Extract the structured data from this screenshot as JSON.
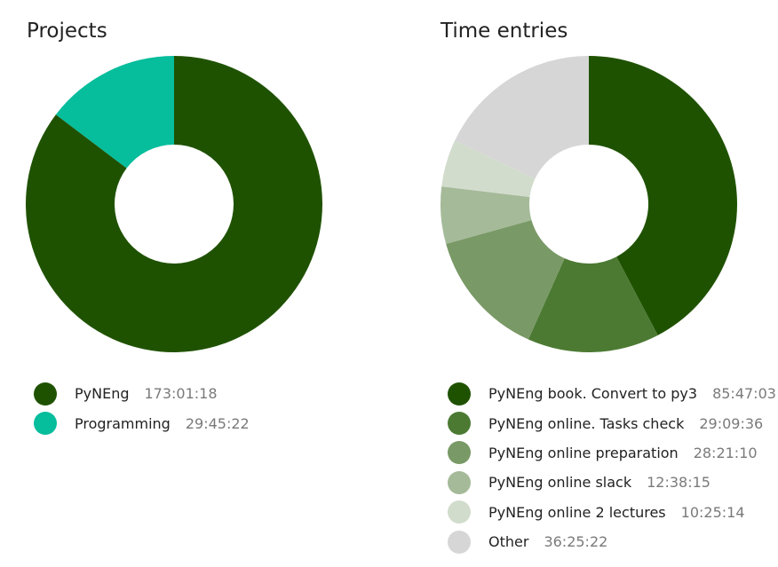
{
  "chart_data": [
    {
      "type": "pie",
      "title": "Projects",
      "slices": [
        {
          "label": "PyNEng",
          "value": "173:01:18",
          "hours": 173.02,
          "color": "#1f5200"
        },
        {
          "label": "Programming",
          "value": "29:45:22",
          "hours": 29.76,
          "color": "#06bd9c"
        }
      ]
    },
    {
      "type": "pie",
      "title": "Time entries",
      "slices": [
        {
          "label": "PyNEng book. Convert to py3",
          "value": "85:47:03",
          "hours": 85.78,
          "color": "#1f5200"
        },
        {
          "label": "PyNEng online. Tasks check",
          "value": "29:09:36",
          "hours": 29.16,
          "color": "#4c7a33"
        },
        {
          "label": "PyNEng online preparation",
          "value": "28:21:10",
          "hours": 28.35,
          "color": "#799966"
        },
        {
          "label": "PyNEng online slack",
          "value": "12:38:15",
          "hours": 12.64,
          "color": "#a5ba99"
        },
        {
          "label": "PyNEng online 2 lectures",
          "value": "10:25:14",
          "hours": 10.42,
          "color": "#d2dccc"
        },
        {
          "label": "Other",
          "value": "36:25:22",
          "hours": 36.42,
          "color": "#d6d6d6"
        }
      ]
    }
  ]
}
